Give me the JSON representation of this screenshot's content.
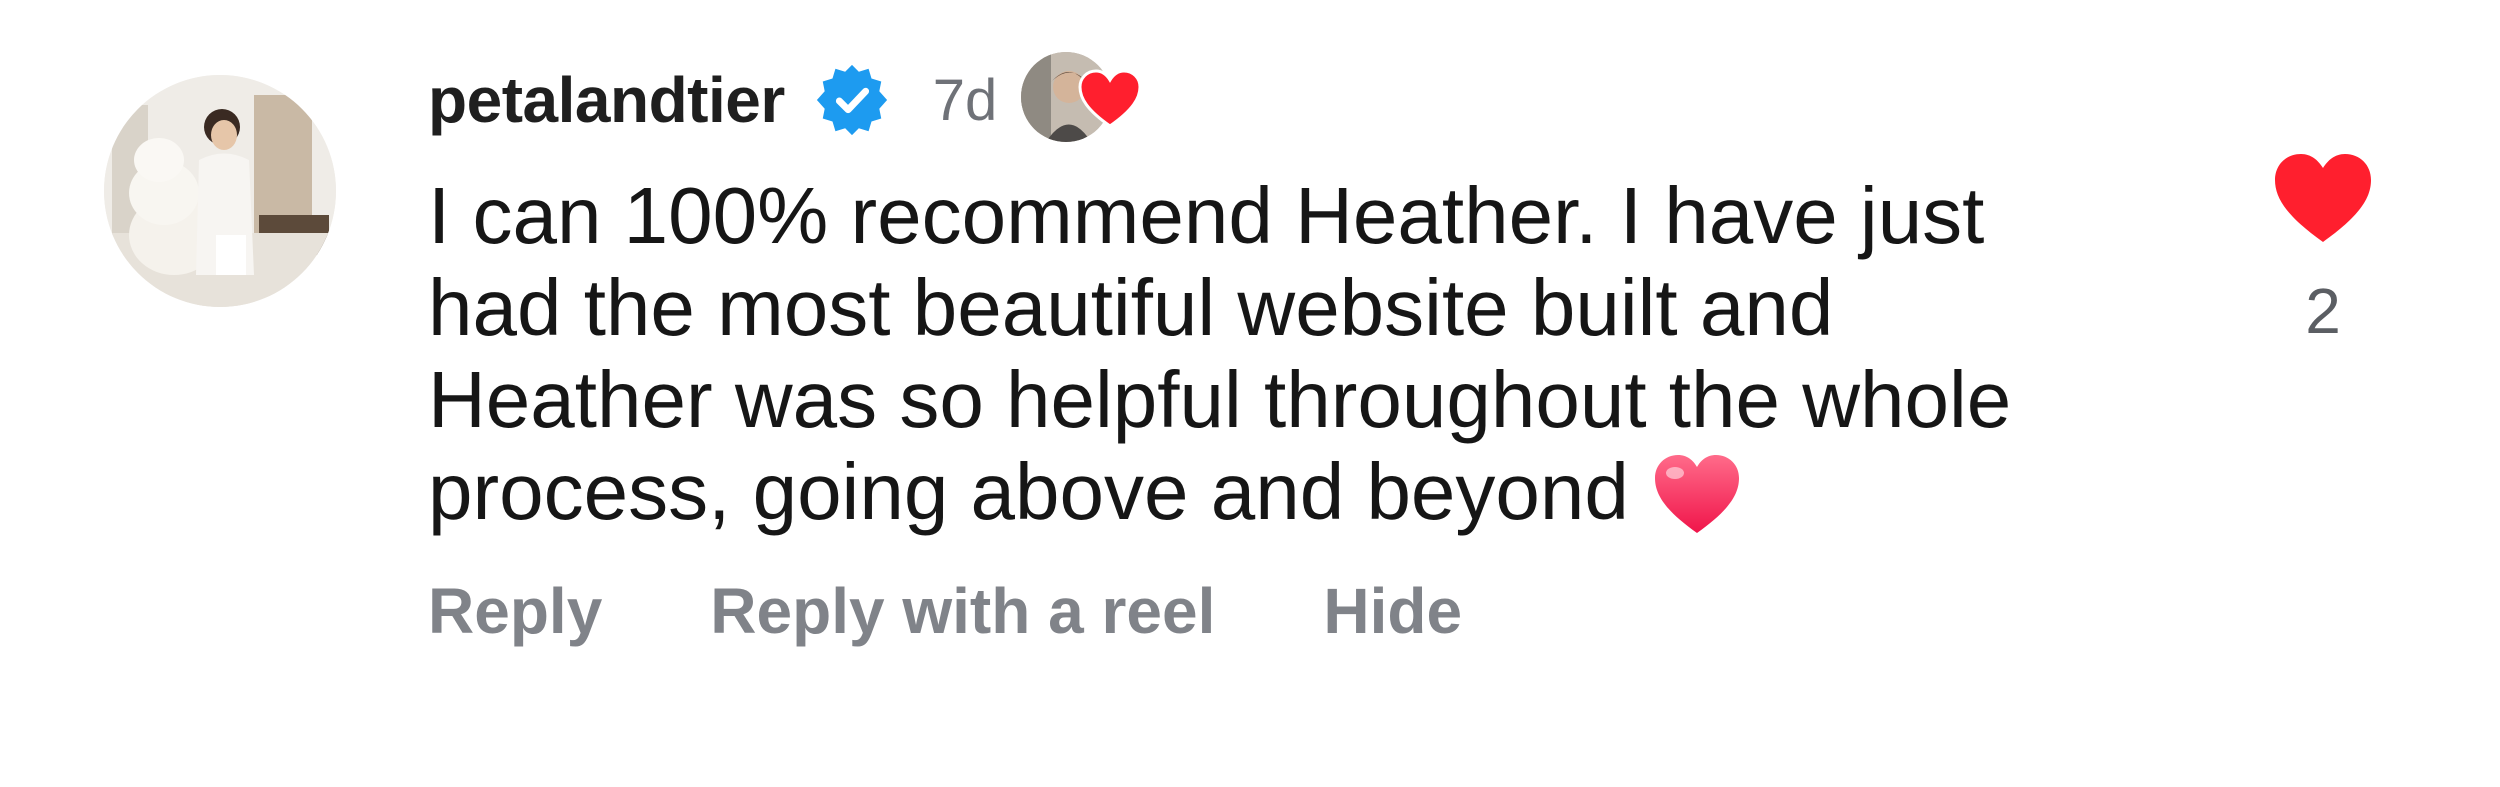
{
  "comment": {
    "avatar_icon": "profile-photo",
    "username": "petalandtier",
    "verified_icon": "verified-badge-icon",
    "timestamp": "7d",
    "liked_by_icon": "creator-liked-avatar-with-heart",
    "text_lines": [
      "I can 100% recommend Heather. I have just",
      "had the most beautiful website built and",
      "Heather was so helpful throughout the whole",
      "process, going above and beyond"
    ],
    "inline_emoji": "heart-emoji",
    "actions": [
      "Reply",
      "Reply with a reel",
      "Hide"
    ],
    "like_icon": "heart-filled-icon",
    "like_count": "2"
  },
  "colors": {
    "verified_blue": "#1D9BF0",
    "heart_red": "#FF1F2E",
    "action_gray": "#808389",
    "timestamp_gray": "#6f7278"
  }
}
